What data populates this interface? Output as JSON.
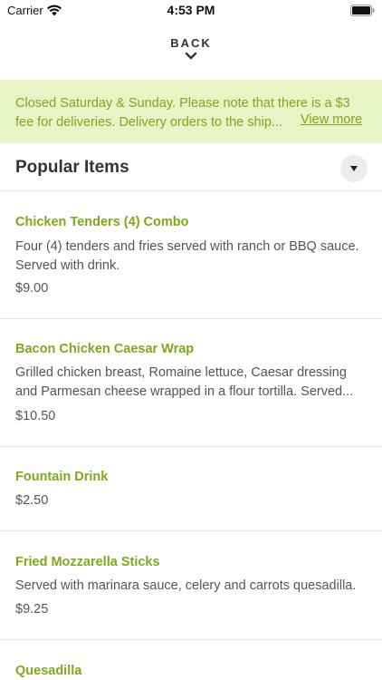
{
  "status_bar": {
    "carrier": "Carrier",
    "time": "4:53 PM",
    "wifi_icon": "wifi-icon",
    "battery_icon": "battery-icon"
  },
  "navigation": {
    "back_label": "BACK",
    "back_icon": "chevron-down-icon"
  },
  "notice": {
    "text": "Closed Saturday & Sunday. Please note that there is a $3 fee for deliveries. Delivery orders to the ship...",
    "view_more_label": "View more",
    "background": "#e8f3c6",
    "accent": "#7fa81a"
  },
  "section": {
    "title": "Popular Items",
    "toggle_icon": "caret-down-icon"
  },
  "items": [
    {
      "name": "Chicken Tenders (4) Combo",
      "description": "Four (4) tenders and fries served with ranch or BBQ sauce. Served with drink.",
      "price": "$9.00"
    },
    {
      "name": "Bacon Chicken Caesar Wrap",
      "description": "Grilled chicken breast, Romaine lettuce, Caesar dressing and Parmesan cheese wrapped in a flour tortilla. Served...",
      "price": "$10.50"
    },
    {
      "name": "Fountain Drink",
      "description": "",
      "price": "$2.50"
    },
    {
      "name": "Fried Mozzarella Sticks",
      "description": "Served with marinara sauce, celery and carrots quesadilla.",
      "price": "$9.25"
    },
    {
      "name": "Quesadilla",
      "description": "",
      "price": ""
    }
  ]
}
